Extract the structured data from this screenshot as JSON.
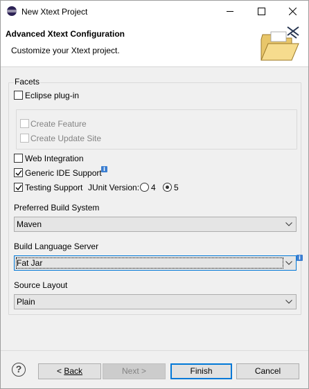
{
  "window": {
    "title": "New Xtext Project"
  },
  "header": {
    "title": "Advanced Xtext Configuration",
    "subtitle": "Customize your Xtext project."
  },
  "facets": {
    "label": "Facets",
    "eclipse_plugin": {
      "label": "Eclipse plug-in",
      "checked": false
    },
    "create_feature": {
      "label": "Create Feature",
      "checked": false,
      "enabled": false
    },
    "create_update_site": {
      "label": "Create Update Site",
      "checked": false,
      "enabled": false
    },
    "web_integration": {
      "label": "Web Integration",
      "checked": false
    },
    "generic_ide": {
      "label": "Generic IDE Support",
      "checked": true
    },
    "testing_support": {
      "label": "Testing Support",
      "checked": true
    },
    "junit_version_label": "JUnit Version:",
    "junit_options": [
      {
        "label": "4",
        "selected": false
      },
      {
        "label": "5",
        "selected": true
      }
    ]
  },
  "build_system": {
    "label": "Preferred Build System",
    "value": "Maven"
  },
  "language_server": {
    "label": "Build Language Server",
    "value": "Fat Jar"
  },
  "source_layout": {
    "label": "Source Layout",
    "value": "Plain"
  },
  "buttons": {
    "back": "Back",
    "next": "Next >",
    "finish": "Finish",
    "cancel": "Cancel"
  },
  "help_icon": "?"
}
